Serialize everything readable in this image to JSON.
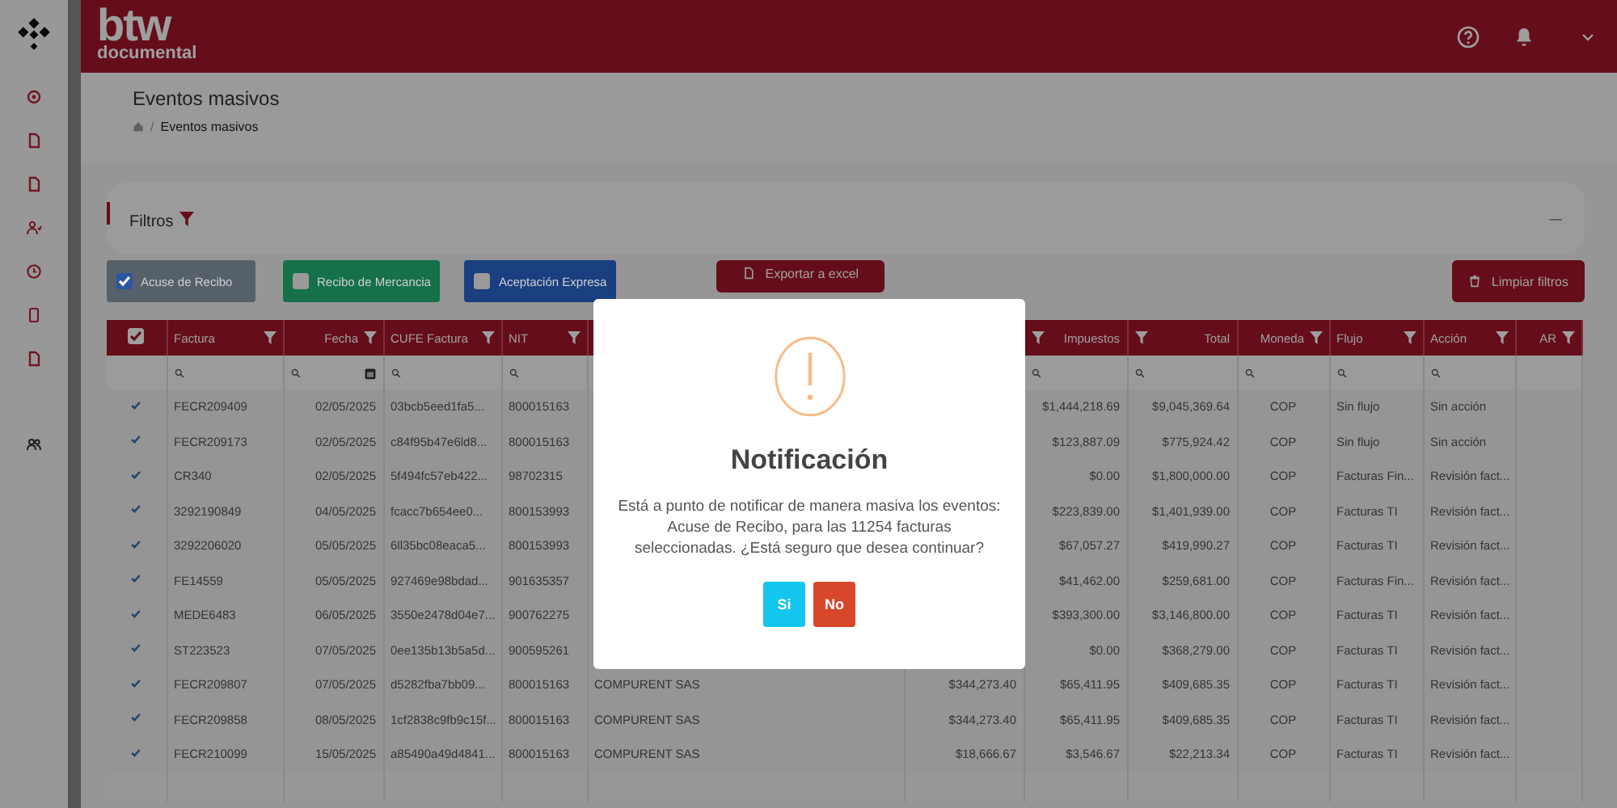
{
  "header": {
    "logo": "btw",
    "logo_sub": "documental"
  },
  "page": {
    "title": "Eventos masivos",
    "separator": "/",
    "breadcrumb": "Eventos masivos"
  },
  "filters": {
    "title": "Filtros",
    "collapse": "—"
  },
  "event_buttons": [
    {
      "label": "Acuse de Recibo",
      "checked": true,
      "color": "#56606a"
    },
    {
      "label": "Recibo de Mercancia",
      "checked": false,
      "color": "#16704a"
    },
    {
      "label": "Aceptación Expresa",
      "checked": false,
      "color": "#1a3f80"
    }
  ],
  "export_button": "Exportar a excel",
  "clear_button": "Limpiar filtros",
  "table": {
    "all_selected": true,
    "columns": [
      {
        "label": "Factura",
        "kind": "text"
      },
      {
        "label": "Fecha",
        "kind": "date"
      },
      {
        "label": "CUFE Factura",
        "kind": "text"
      },
      {
        "label": "NIT",
        "kind": "text"
      },
      {
        "kind": "text"
      },
      {
        "kind": "money"
      },
      {
        "label": "Impuestos",
        "kind": "money"
      },
      {
        "label": "Total",
        "kind": "money"
      },
      {
        "label": "Moneda",
        "kind": "center"
      },
      {
        "label": "Flujo",
        "kind": "text"
      },
      {
        "label": "Acción",
        "kind": "text"
      },
      {
        "label": "AR",
        "kind": "plain"
      }
    ],
    "rows": [
      {
        "selected": true,
        "factura": "FECR209409",
        "fecha": "02/05/2025",
        "cufe": "03bcb5eed1fa5...",
        "nit": "800015163",
        "impuestos": "$1,444,218.69",
        "total": "$9,045,369.64",
        "moneda": "COP",
        "flujo": "Sin flujo",
        "accion": "Sin acción"
      },
      {
        "selected": true,
        "factura": "FECR209173",
        "fecha": "02/05/2025",
        "cufe": "c84f95b47e6ld8...",
        "nit": "800015163",
        "impuestos": "$123,887.09",
        "total": "$775,924.42",
        "moneda": "COP",
        "flujo": "Sin flujo",
        "accion": "Sin acción"
      },
      {
        "selected": true,
        "factura": "CR340",
        "fecha": "02/05/2025",
        "cufe": "5f494fc57eb422...",
        "nit": "98702315",
        "impuestos": "$0.00",
        "total": "$1,800,000.00",
        "moneda": "COP",
        "flujo": "Facturas Fin...",
        "accion": "Revisión fact..."
      },
      {
        "selected": true,
        "factura": "3292190849",
        "fecha": "04/05/2025",
        "cufe": "fcacc7b654ee0...",
        "nit": "800153993",
        "impuestos": "$223,839.00",
        "total": "$1,401,939.00",
        "moneda": "COP",
        "flujo": "Facturas TI",
        "accion": "Revisión fact..."
      },
      {
        "selected": true,
        "factura": "3292206020",
        "fecha": "05/05/2025",
        "cufe": "6ll35bc08eaca5...",
        "nit": "800153993",
        "impuestos": "$67,057.27",
        "total": "$419,990.27",
        "moneda": "COP",
        "flujo": "Facturas TI",
        "accion": "Revisión fact..."
      },
      {
        "selected": true,
        "factura": "FE14559",
        "fecha": "05/05/2025",
        "cufe": "927469e98bdad...",
        "nit": "901635357",
        "impuestos": "$41,462.00",
        "total": "$259,681.00",
        "moneda": "COP",
        "flujo": "Facturas Fin...",
        "accion": "Revisión fact..."
      },
      {
        "selected": true,
        "factura": "MEDE6483",
        "fecha": "06/05/2025",
        "cufe": "3550e2478d04e7...",
        "nit": "900762275",
        "impuestos": "$393,300.00",
        "total": "$3,146,800.00",
        "moneda": "COP",
        "flujo": "Facturas TI",
        "accion": "Revisión fact..."
      },
      {
        "selected": true,
        "factura": "ST223523",
        "fecha": "07/05/2025",
        "cufe": "0ee135b13b5a5d...",
        "nit": "900595261",
        "impuestos": "$0.00",
        "total": "$368,279.00",
        "moneda": "COP",
        "flujo": "Facturas TI",
        "accion": "Revisión fact..."
      },
      {
        "selected": true,
        "factura": "FECR209807",
        "fecha": "07/05/2025",
        "cufe": "d5282fba7bb09...",
        "nit": "800015163",
        "column_5": "COMPURENT SAS",
        "column_6": "$344,273.40",
        "impuestos": "$65,411.95",
        "total": "$409,685.35",
        "moneda": "COP",
        "flujo": "Facturas TI",
        "accion": "Revisión fact..."
      },
      {
        "selected": true,
        "factura": "FECR209858",
        "fecha": "08/05/2025",
        "cufe": "1cf2838c9fb9c15f...",
        "nit": "800015163",
        "column_5": "COMPURENT SAS",
        "column_6": "$344,273.40",
        "impuestos": "$65,411.95",
        "total": "$409,685.35",
        "moneda": "COP",
        "flujo": "Facturas TI",
        "accion": "Revisión fact..."
      },
      {
        "selected": true,
        "factura": "FECR210099",
        "fecha": "15/05/2025",
        "cufe": "a85490a49d4841...",
        "nit": "800015163",
        "column_5": "COMPURENT SAS",
        "column_6": "$18,666.67",
        "impuestos": "$3,546.67",
        "total": "$22,213.34",
        "moneda": "COP",
        "flujo": "Facturas TI",
        "accion": "Revisión fact..."
      }
    ]
  },
  "modal": {
    "title": "Notificación",
    "message": "Está a punto de notificar de manera masiva los eventos: Acuse de Recibo, para las 11254 facturas seleccionadas. ¿Está seguro que desea continuar?",
    "buttons": [
      {
        "label": "Si",
        "kind": "confirm"
      },
      {
        "label": "No",
        "kind": "cancel"
      }
    ]
  }
}
